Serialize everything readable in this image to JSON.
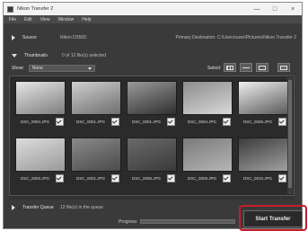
{
  "window": {
    "title": "Nikon Transfer 2"
  },
  "controls": {
    "minimize": "—",
    "maximize": "□",
    "close": "×"
  },
  "menu": [
    "File",
    "Edit",
    "View",
    "Window",
    "Help"
  ],
  "source": {
    "label": "Source",
    "name": "Nikon D3500",
    "destination": "Primary Destination: C:\\Users\\user\\Pictures\\Nikon Transfer 2"
  },
  "thumbnails": {
    "label": "Thumbnails",
    "count": "0 of 12 file(s) selected"
  },
  "toolbar": {
    "show_label": "Show:",
    "show_value": "None",
    "select_label": "Select:"
  },
  "photos": [
    {
      "name": "DSC_0004.JPG",
      "colors": [
        "#e6e6e6",
        "#7e7e7e"
      ]
    },
    {
      "name": "DSC_0001.JPG",
      "colors": [
        "#cfcfcf",
        "#6e6e6e"
      ]
    },
    {
      "name": "DSC_0001.JPG",
      "colors": [
        "#9a9a9a",
        "#2f2f2f"
      ]
    },
    {
      "name": "DSC_0004.JPG",
      "colors": [
        "#8c8c8c",
        "#d8d8d8"
      ]
    },
    {
      "name": "DSC_0005.JPG",
      "colors": [
        "#f0f0f0",
        "#5a5a5a"
      ]
    },
    {
      "name": "DSC_0003.JPG",
      "colors": [
        "#dcdcdc",
        "#9a9a9a"
      ]
    },
    {
      "name": "DSC_0001.JPG",
      "colors": [
        "#8a8a8a",
        "#4a4a4a"
      ]
    },
    {
      "name": "DSC_0006.JPG",
      "colors": [
        "#6a6a6a",
        "#3a3a3a"
      ]
    },
    {
      "name": "DSC_0008.JPG",
      "colors": [
        "#7a7a7a",
        "#b5b5b5"
      ]
    },
    {
      "name": "DSC_0010.JPG",
      "colors": [
        "#3c3c3c",
        "#a0a0a0"
      ]
    }
  ],
  "queue": {
    "label": "Transfer Queue",
    "count": "12 file(s) in the queue"
  },
  "status": {
    "progress_label": "Progress:",
    "progress": 0
  },
  "start_button": {
    "label": "Start Transfer"
  },
  "highlight_color": "#c41e2a"
}
